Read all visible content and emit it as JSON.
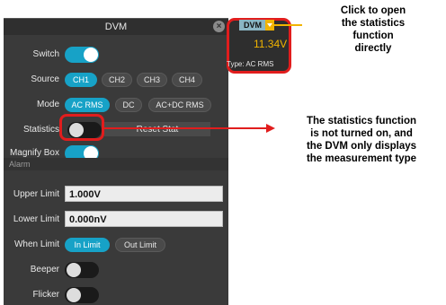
{
  "panel": {
    "title": "DVM",
    "close_glyph": "×",
    "switch": {
      "label": "Switch",
      "state": "on"
    },
    "source": {
      "label": "Source",
      "options": [
        "CH1",
        "CH2",
        "CH3",
        "CH4"
      ],
      "selected": "CH1"
    },
    "mode": {
      "label": "Mode",
      "options": [
        "AC RMS",
        "DC",
        "AC+DC RMS"
      ],
      "selected": "AC RMS"
    },
    "statistics": {
      "label": "Statistics",
      "state": "off",
      "reset_label": "Reset Stat"
    },
    "magnify": {
      "label": "Magnify Box",
      "state": "on"
    },
    "alarm_section": "Alarm",
    "upper_limit": {
      "label": "Upper Limit",
      "value": "1.000V"
    },
    "lower_limit": {
      "label": "Lower Limit",
      "value": "0.000nV"
    },
    "when_limit": {
      "label": "When Limit",
      "options": [
        "In Limit",
        "Out Limit"
      ],
      "selected": "In Limit"
    },
    "beeper": {
      "label": "Beeper",
      "state": "off"
    },
    "flicker": {
      "label": "Flicker",
      "state": "off"
    }
  },
  "dvm_widget": {
    "tab_label": "DVM",
    "value": "11.34V",
    "type_text": "Type: AC RMS"
  },
  "annotations": {
    "top": [
      "Click to open",
      "the statistics",
      "function",
      "directly"
    ],
    "middle": [
      "The statistics function",
      "is not turned on, and",
      "the DVM only displays",
      "the measurement type"
    ]
  },
  "colors": {
    "accent": "#17a2c7",
    "highlight": "#e11d1d",
    "callout_line": "#f1b400",
    "value": "#f1b400"
  },
  "icons": {
    "close": "close-icon",
    "dropdown": "chevron-down-icon",
    "arrow": "arrow-right-icon"
  }
}
